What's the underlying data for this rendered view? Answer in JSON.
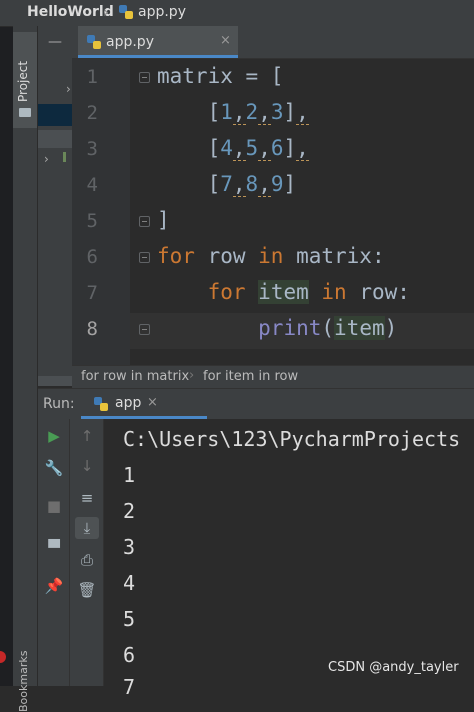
{
  "navbar": {
    "project": "HelloWorld",
    "file": "app.py"
  },
  "side_strip": {
    "project_tab": "Project",
    "bookmarks_tab": "Bookmarks"
  },
  "editor": {
    "tab": {
      "label": "app.py",
      "close": "×"
    },
    "line_numbers": [
      "1",
      "2",
      "3",
      "4",
      "5",
      "6",
      "7",
      "8"
    ],
    "lines": [
      "matrix = [",
      "    [1,2,3],",
      "    [4,5,6],",
      "    [7,8,9]",
      "]",
      "for row in matrix:",
      "    for item in row:",
      "        print(item)"
    ]
  },
  "breadcrumb": [
    "for row in matrix",
    "for item in row"
  ],
  "run": {
    "label": "Run:",
    "tab": {
      "label": "app",
      "close": "×"
    },
    "output": [
      "C:\\Users\\123\\PycharmProjects",
      "1",
      "2",
      "3",
      "4",
      "5",
      "6",
      "7"
    ]
  },
  "watermark": "CSDN @andy_tayler",
  "colors": {
    "keyword": "#cc7832",
    "number": "#6897bb",
    "builtin": "#8888c6",
    "tab_underline": "#4a88c7",
    "run_green": "#499c54"
  }
}
